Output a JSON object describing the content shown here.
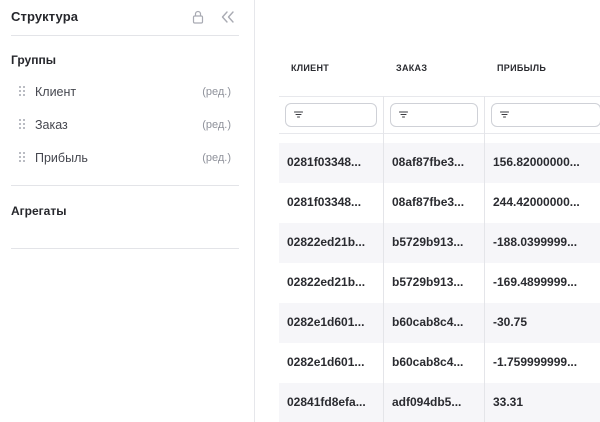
{
  "sidebar": {
    "title": "Структура",
    "groups_title": "Группы",
    "groups": [
      {
        "label": "Клиент",
        "edit": "(ред.)"
      },
      {
        "label": "Заказ",
        "edit": "(ред.)"
      },
      {
        "label": "Прибыль",
        "edit": "(ред.)"
      }
    ],
    "aggregates_title": "Агрегаты"
  },
  "grid": {
    "columns": [
      "КЛИЕНТ",
      "ЗАКАЗ",
      "ПРИБЫЛЬ"
    ],
    "rows": [
      [
        "0281f03348...",
        "08af87fbe3...",
        "156.82000000..."
      ],
      [
        "0281f03348...",
        "08af87fbe3...",
        "244.42000000..."
      ],
      [
        "02822ed21b...",
        "b5729b913...",
        "-188.0399999..."
      ],
      [
        "02822ed21b...",
        "b5729b913...",
        "-169.4899999..."
      ],
      [
        "0282e1d601...",
        "b60cab8c4...",
        "-30.75"
      ],
      [
        "0282e1d601...",
        "b60cab8c4...",
        "-1.759999999..."
      ],
      [
        "02841fd8efa...",
        "adf094db5...",
        "33.31"
      ]
    ]
  },
  "icons": {
    "lock": "lock-icon",
    "collapse": "double-chevron-left-icon",
    "filter": "filter-icon",
    "drag": "drag-handle-icon"
  },
  "colors": {
    "text": "#1f1f24",
    "muted": "#8f929b",
    "row_shade": "#f6f6f9",
    "border": "#e4e5e9"
  }
}
